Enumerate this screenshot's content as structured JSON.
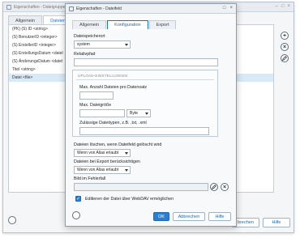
{
  "background_window": {
    "title": "Eigenschaften - Dateigruppe",
    "tabs": [
      "Allgemein",
      "Dateienfel"
    ],
    "rows": [
      "(PK) (S) ID <string>",
      "(S) BenutzerID <integer>",
      "(S) ErstellerID <integer>",
      "(S) ErstellungsDatum <datel",
      "(S) ÄnderungsDatum <datel",
      "Titel <string>",
      "Datei <file>"
    ],
    "selected_row_index": 6,
    "buttons": {
      "cancel": "brechen",
      "help": "Hilfe"
    }
  },
  "dialog": {
    "title": "Eigenschaften - Dateifeld",
    "tabs": [
      {
        "label": "Allgemein",
        "active": false
      },
      {
        "label": "Konfiguration",
        "active": true
      },
      {
        "label": "Export",
        "active": false
      }
    ],
    "storage_location": {
      "label": "Dateispeicherort",
      "value": "system"
    },
    "relative_path": {
      "label": "Relativpfad",
      "value": ""
    },
    "upload": {
      "group_title": "UPLOAD-EINSTELLUNGEN",
      "max_files": {
        "label": "Max. Anzahl Dateien pro Datensatz",
        "value": ""
      },
      "max_size": {
        "label": "Max. Dateigröße",
        "value": "",
        "unit": "Byte"
      },
      "allowed_types": {
        "label": "Zulässige Dateitypen, z.B. .txt, .xml",
        "value": ""
      }
    },
    "delete_files": {
      "label": "Dateien löschen, wenn Dateifeld gelöscht wird",
      "value": "Wenn von Alias erlaubt"
    },
    "export_files": {
      "label": "Dateien bei Export berücksichtigen",
      "value": "Wenn von Alias erlaubt"
    },
    "error_image": {
      "label": "Bild im Fehlerfall",
      "value": ""
    },
    "webdav": {
      "label": "Editieren der Datei über WebDAV ermöglichen",
      "checked": true
    },
    "buttons": {
      "ok": "OK",
      "cancel": "Abbrechen",
      "help": "Hilfe"
    }
  }
}
